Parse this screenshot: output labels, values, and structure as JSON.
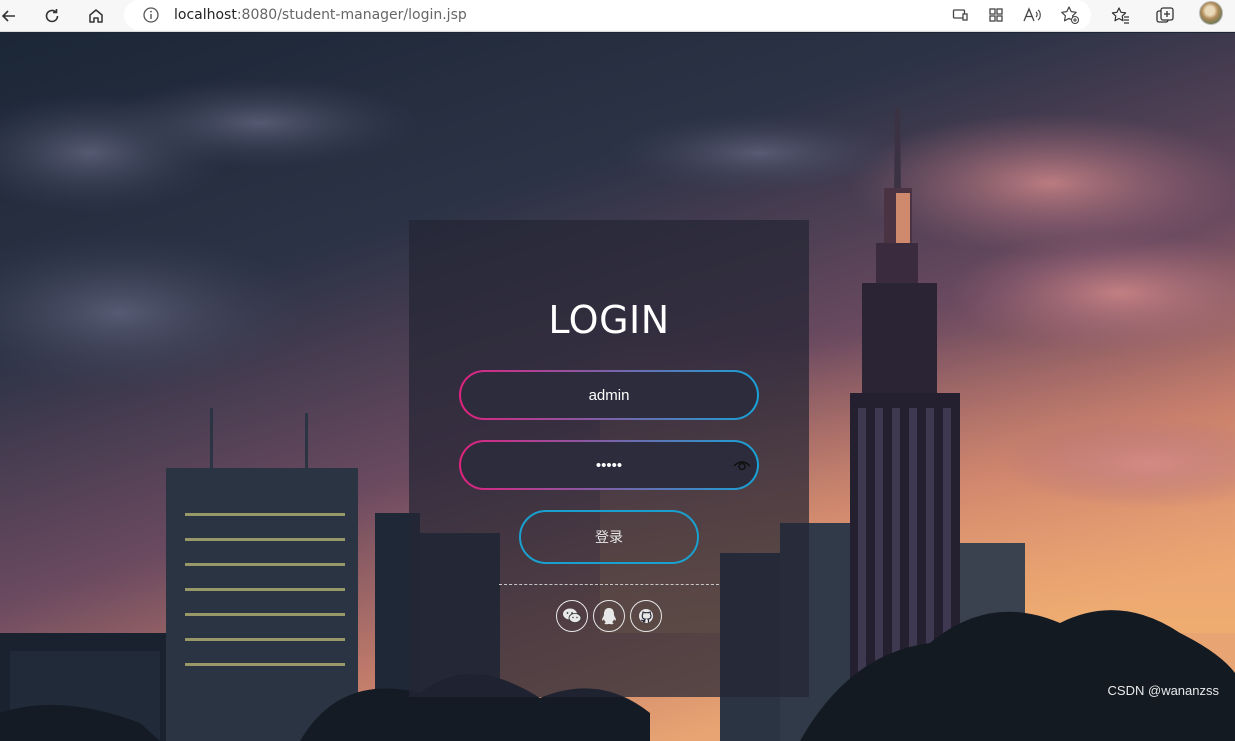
{
  "browser": {
    "url_host": "localhost",
    "url_rest": ":8080/student-manager/login.jsp"
  },
  "login": {
    "title": "LOGIN",
    "username_value": "admin",
    "password_value": "admin",
    "submit_label": "登录"
  },
  "social": [
    "wechat-icon",
    "qq-icon",
    "github-icon"
  ],
  "watermark": "CSDN @wananzss",
  "colors": {
    "gradient_start": "#e0227e",
    "gradient_end": "#17a2d6",
    "card_bg": "rgba(36,37,52,0.72)"
  }
}
